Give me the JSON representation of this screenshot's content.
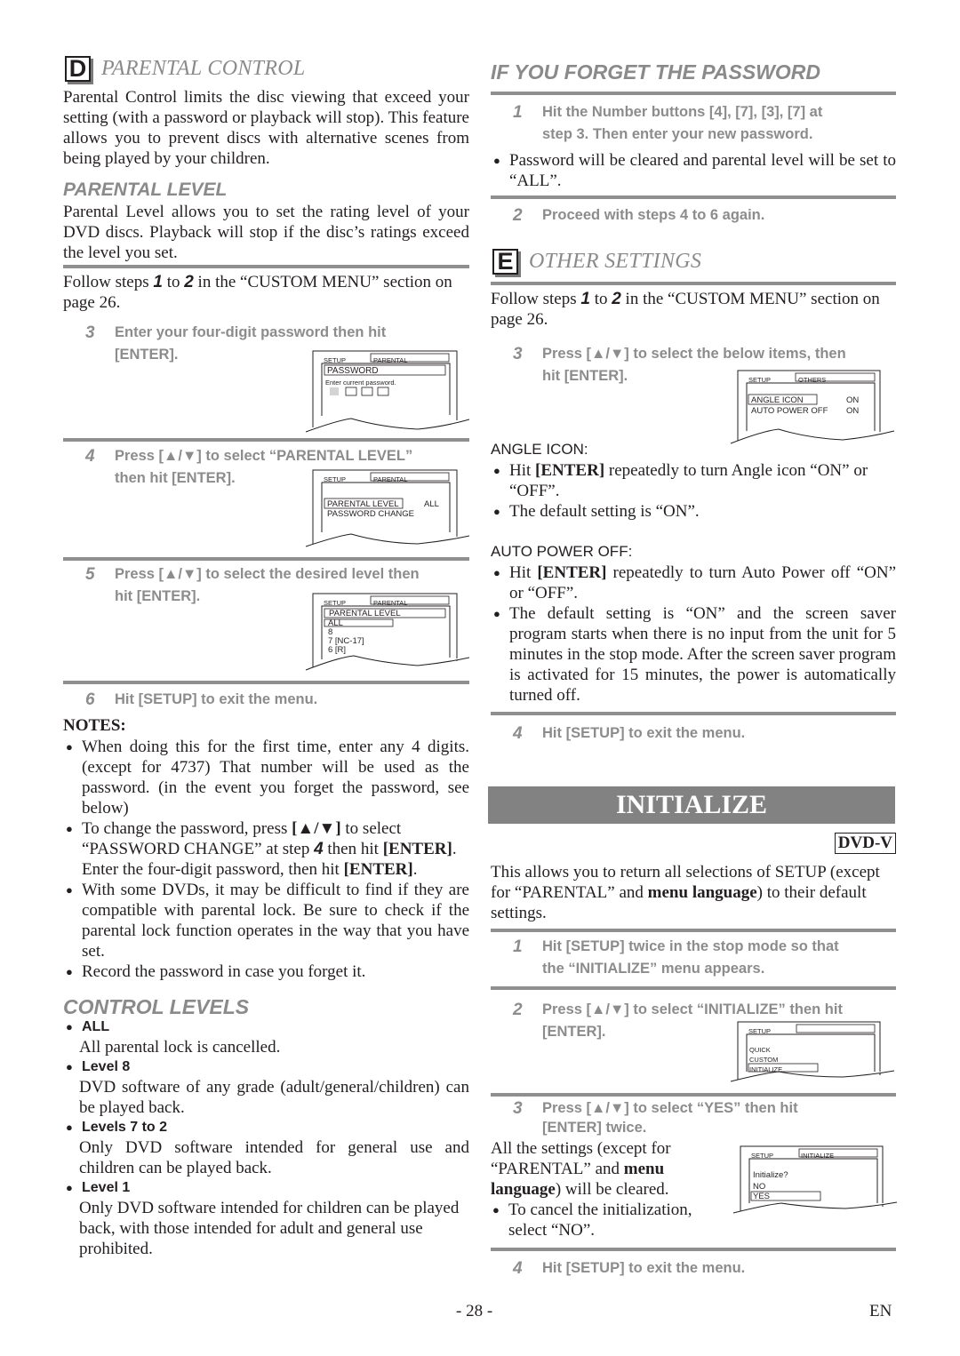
{
  "parental_control": {
    "letter": "D",
    "title": "PARENTAL CONTROL",
    "intro": "Parental Control limits the disc viewing that exceed your setting (with a password or playback will stop). This feature allows you to prevent discs with alternative scenes from being played by your children.",
    "parental_level": {
      "title": "PARENTAL LEVEL",
      "text": "Parental Level allows you to set the rating level of your DVD discs. Playback will stop if the disc’s ratings exceed the level you set."
    },
    "follow": {
      "pre": "Follow steps ",
      "s1": "1",
      "mid": " to ",
      "s2": "2",
      "post": " in the “CUSTOM MENU” section on page 26."
    },
    "steps": [
      {
        "num": "3",
        "line1": "Enter your four-digit password then hit",
        "line2": "[ENTER]."
      },
      {
        "num": "4",
        "line1": "Press [▲/▼] to select “PARENTAL LEVEL”",
        "line2": "then hit [ENTER]."
      },
      {
        "num": "5",
        "line1": "Press [▲/▼] to select the desired level then",
        "line2": "hit [ENTER]."
      },
      {
        "num": "6",
        "line1": "Hit [SETUP] to exit the menu."
      }
    ],
    "screens": {
      "password": {
        "setup": "SETUP",
        "tab": "PARENTAL",
        "heading": "PASSWORD",
        "prompt": "Enter current password."
      },
      "level_menu": {
        "setup": "SETUP",
        "tab": "PARENTAL",
        "item1": "PARENTAL LEVEL",
        "item1_value": "ALL",
        "item2": "PASSWORD CHANGE"
      },
      "level_select": {
        "setup": "SETUP",
        "tab": "PARENTAL",
        "heading": "PARENTAL LEVEL",
        "options": [
          "ALL",
          "8",
          "7 [NC-17]",
          "6 [R]"
        ]
      }
    },
    "notes": {
      "title": "NOTES:",
      "items": [
        "When doing this for the first time, enter any 4 digits. (except for 4737) That number will be used as the password. (in the event you forget the password, see below)",
        "To change the password, press [▲/▼] to select “PASSWORD CHANGE” at step 4 then hit [ENTER]. Enter the four-digit password, then hit [ENTER].",
        "With some DVDs, it may be difficult to find if they are compatible with parental lock. Be sure to check if the parental lock function operates in the way that you have set.",
        "Record the password in case you forget it."
      ]
    },
    "control_levels": {
      "title": "CONTROL LEVELS",
      "items": [
        {
          "label": "ALL",
          "text": "All parental lock is cancelled."
        },
        {
          "label": "Level 8",
          "text": "DVD software of any grade (adult/general/children) can be played back."
        },
        {
          "label": "Levels 7 to 2",
          "text": "Only DVD software intended for general use and children can be played back."
        },
        {
          "label": "Level 1",
          "text": "Only DVD software intended for children can be played back, with those intended for adult and general use prohibited."
        }
      ]
    }
  },
  "forget_password": {
    "title": "IF YOU FORGET THE PASSWORD",
    "step1": {
      "num": "1",
      "line1": "Hit the Number buttons [4], [7], [3], [7] at",
      "line2": "step 3. Then enter your new password."
    },
    "bullet": "Password will be cleared and parental level will be set to “ALL”.",
    "step2": {
      "num": "2",
      "text": "Proceed with steps 4 to 6 again."
    }
  },
  "other_settings": {
    "letter": "E",
    "title": "OTHER SETTINGS",
    "follow": {
      "pre": "Follow steps ",
      "s1": "1",
      "mid": " to ",
      "s2": "2",
      "post": " in the “CUSTOM MENU” section on page 26."
    },
    "step3": {
      "num": "3",
      "line1": "Press [▲/▼] to select the below items, then",
      "line2": "hit [ENTER]."
    },
    "screen": {
      "setup": "SETUP",
      "tab": "OTHERS",
      "item1": "ANGLE ICON",
      "item1_value": "ON",
      "item2": "AUTO POWER OFF",
      "item2_value": "ON"
    },
    "angle_icon": {
      "title": "ANGLE ICON:",
      "items": [
        "Hit [ENTER] repeatedly to turn Angle icon “ON” or “OFF”.",
        "The default setting is “ON”."
      ]
    },
    "auto_power_off": {
      "title": "AUTO POWER OFF:",
      "items": [
        "Hit [ENTER] repeatedly to turn Auto Power off “ON” or “OFF”.",
        "The default setting is “ON” and the screen saver program starts when there is no input from the unit for 5 minutes in the stop mode. After the screen saver program is activated for 15 minutes, the power is automatically turned off."
      ]
    },
    "step4": {
      "num": "4",
      "text": "Hit [SETUP] to exit the menu."
    }
  },
  "initialize": {
    "title": "INITIALIZE",
    "badge": "DVD-V",
    "intro_pre": "This allows you to return all selections of SETUP (except for “PARENTAL” and ",
    "intro_bold": "menu language",
    "intro_post": ") to their default settings.",
    "step1": {
      "num": "1",
      "line1": "Hit [SETUP] twice in the stop mode so that",
      "line2": "the “INITIALIZE” menu appears."
    },
    "step2": {
      "num": "2",
      "line1": "Press [▲/▼] to select “INITIALIZE” then hit",
      "line2": "[ENTER]."
    },
    "screen2": {
      "setup": "SETUP",
      "tab": "",
      "items": [
        "QUICK",
        "CUSTOM",
        "INITIALIZE"
      ]
    },
    "step3": {
      "num": "3",
      "line1": "Press [▲/▼] to select “YES” then hit",
      "line2": "[ENTER] twice."
    },
    "step3_text_pre": "All the settings (except for “PARENTAL” and ",
    "step3_text_bold1": "menu",
    "step3_text_bold2": "language",
    "step3_text_post": ") will be cleared.",
    "step3_bullet": "To cancel the initialization, select “NO”.",
    "screen3": {
      "setup": "SETUP",
      "tab": "INITIALIZE",
      "question": "Initialize?",
      "options": [
        "NO",
        "YES"
      ]
    },
    "step4": {
      "num": "4",
      "text": "Hit [SETUP] to exit the menu."
    }
  },
  "footer": {
    "page": "- 28 -",
    "lang": "EN"
  }
}
